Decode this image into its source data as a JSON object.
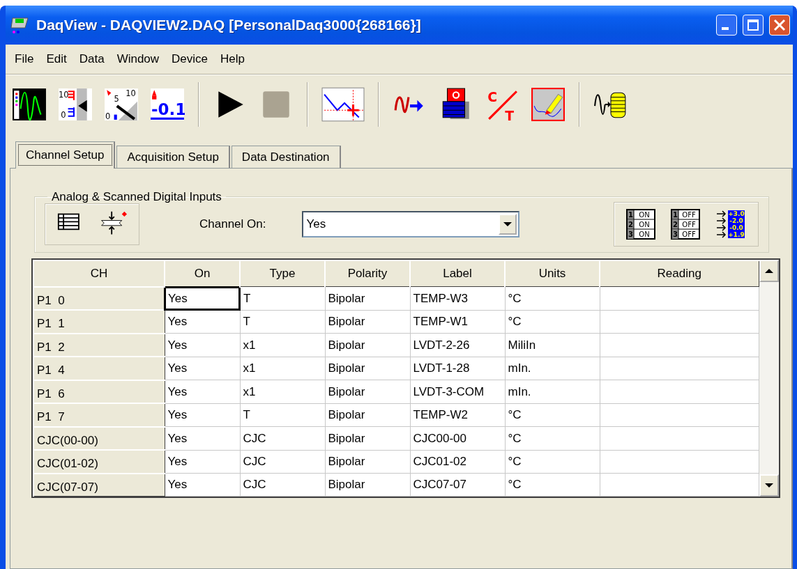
{
  "window": {
    "title": "DaqView - DAQVIEW2.DAQ [PersonalDaq3000{268166}]"
  },
  "menu": [
    {
      "label": "File"
    },
    {
      "label": "Edit"
    },
    {
      "label": "Data"
    },
    {
      "label": "Window"
    },
    {
      "label": "Device"
    },
    {
      "label": "Help"
    }
  ],
  "toolbar": [
    {
      "kind": "scope"
    },
    {
      "kind": "bargraph",
      "labels": [
        "10",
        "0"
      ]
    },
    {
      "kind": "meter",
      "labels": [
        "5",
        "10",
        "0"
      ]
    },
    {
      "kind": "digital",
      "labels": [
        "-0.1"
      ]
    },
    {
      "kind": "separator"
    },
    {
      "kind": "play"
    },
    {
      "kind": "stop"
    },
    {
      "kind": "separator"
    },
    {
      "kind": "chart"
    },
    {
      "kind": "separator"
    },
    {
      "kind": "wave-out"
    },
    {
      "kind": "disk"
    },
    {
      "kind": "counter",
      "labels": [
        "C",
        "T"
      ]
    },
    {
      "kind": "edit-chart"
    },
    {
      "kind": "separator"
    },
    {
      "kind": "wave-store"
    }
  ],
  "tabs": [
    {
      "label": "Channel Setup",
      "selected": true
    },
    {
      "label": "Acquisition Setup",
      "selected": false
    },
    {
      "label": "Data Destination",
      "selected": false
    }
  ],
  "group": {
    "title": "Analog & Scanned Digital Inputs",
    "left_tools": [
      {
        "kind": "grid"
      },
      {
        "kind": "compress"
      }
    ],
    "channel_on": {
      "label": "Channel On:",
      "value": "Yes"
    },
    "right_tools": [
      {
        "kind": "all-on",
        "labels": [
          "1",
          "ON",
          "2",
          "ON",
          "3",
          "ON"
        ]
      },
      {
        "kind": "all-off",
        "labels": [
          "1",
          "OFF",
          "2",
          "OFF",
          "3",
          "OFF"
        ]
      },
      {
        "kind": "readings",
        "labels": [
          "+3.0",
          "-2.0",
          "-0.0",
          "+1.9"
        ]
      }
    ]
  },
  "table": {
    "columns": [
      "CH",
      "On",
      "Type",
      "Polarity",
      "Label",
      "Units",
      "Reading"
    ],
    "rows": [
      {
        "ch": "P1  0",
        "on": "Yes",
        "type": "T",
        "polarity": "Bipolar",
        "label": "TEMP-W3",
        "units": "°C",
        "focused": true
      },
      {
        "ch": "P1  1",
        "on": "Yes",
        "type": "T",
        "polarity": "Bipolar",
        "label": "TEMP-W1",
        "units": "°C",
        "focused": false
      },
      {
        "ch": "P1  2",
        "on": "Yes",
        "type": "x1",
        "polarity": "Bipolar",
        "label": "LVDT-2-26",
        "units": "MiliIn",
        "focused": false
      },
      {
        "ch": "P1  4",
        "on": "Yes",
        "type": "x1",
        "polarity": "Bipolar",
        "label": "LVDT-1-28",
        "units": "mIn.",
        "focused": false
      },
      {
        "ch": "P1  6",
        "on": "Yes",
        "type": "x1",
        "polarity": "Bipolar",
        "label": "LVDT-3-COM",
        "units": "mIn.",
        "focused": false
      },
      {
        "ch": "P1  7",
        "on": "Yes",
        "type": "T",
        "polarity": "Bipolar",
        "label": "TEMP-W2",
        "units": "°C",
        "focused": false
      },
      {
        "ch": "CJC(00-00)",
        "on": "Yes",
        "type": "CJC",
        "polarity": "Bipolar",
        "label": "CJC00-00",
        "units": "°C",
        "focused": false
      },
      {
        "ch": "CJC(01-02)",
        "on": "Yes",
        "type": "CJC",
        "polarity": "Bipolar",
        "label": "CJC01-02",
        "units": "°C",
        "focused": false
      },
      {
        "ch": "CJC(07-07)",
        "on": "Yes",
        "type": "CJC",
        "polarity": "Bipolar",
        "label": "CJC07-07",
        "units": "°C",
        "focused": false
      }
    ]
  }
}
